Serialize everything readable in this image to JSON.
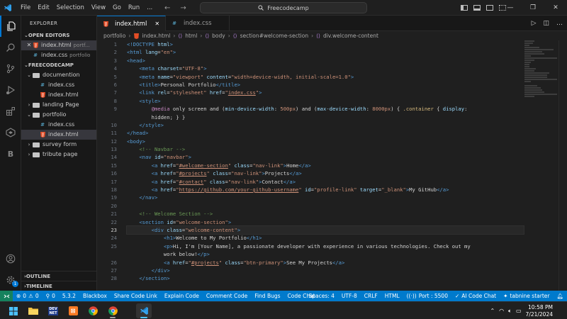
{
  "menu": [
    "File",
    "Edit",
    "Selection",
    "View",
    "Go",
    "Run",
    "..."
  ],
  "search": {
    "text": "Freecodecamp"
  },
  "sidebar": {
    "title": "EXPLORER",
    "open_editors_label": "OPEN EDITORS",
    "open_editors": [
      {
        "name": "index.html",
        "folder": "portf..."
      },
      {
        "name": "index.css",
        "folder": "portfolio"
      }
    ],
    "workspace_label": "FREECODECAMP",
    "tree": [
      {
        "label": "documention",
        "kind": "folder",
        "open": true
      },
      {
        "label": "index.css",
        "kind": "css"
      },
      {
        "label": "index.html",
        "kind": "html"
      },
      {
        "label": "landing Page",
        "kind": "folder",
        "open": false
      },
      {
        "label": "portfolio",
        "kind": "folder",
        "open": true
      },
      {
        "label": "index.css",
        "kind": "css"
      },
      {
        "label": "index.html",
        "kind": "html"
      },
      {
        "label": "survey form",
        "kind": "folder",
        "open": false
      },
      {
        "label": "tribute page",
        "kind": "folder",
        "open": false
      }
    ],
    "outline_label": "OUTLINE",
    "timeline_label": "TIMELINE"
  },
  "tabs": [
    {
      "label": "index.html",
      "active": true
    },
    {
      "label": "index.css",
      "active": false
    }
  ],
  "breadcrumb": [
    "portfolio",
    "index.html",
    "html",
    "body",
    "section#welcome-section",
    "div.welcome-content"
  ],
  "editor": {
    "line_numbers": [
      "1",
      "2",
      "3",
      "4",
      "5",
      "6",
      "7",
      "8",
      "9",
      "",
      "10",
      "11",
      "12",
      "13",
      "14",
      "15",
      "16",
      "17",
      "18",
      "19",
      "20",
      "21",
      "22",
      "23",
      "24",
      "25",
      "",
      "26",
      "27",
      "28"
    ],
    "current_line": "23"
  },
  "status": {
    "errors": "0",
    "warnings": "0",
    "ports": "0",
    "version": "5.3.2",
    "items_left": [
      "Blackbox",
      "Share Code Link",
      "Explain Code",
      "Comment Code",
      "Find Bugs",
      "Code Chat"
    ],
    "spaces": "Spaces: 4",
    "encoding": "UTF-8",
    "eol": "CRLF",
    "language": "HTML",
    "port": "Port : 5500",
    "ai_chat": "AI Code Chat",
    "tabnine": "tabnine starter"
  },
  "clock": {
    "time": "10:58 PM",
    "date": "7/21/2024"
  },
  "colors": {
    "statusbar": "#007acc",
    "remote": "#16825d",
    "accent": "#0078d4"
  }
}
